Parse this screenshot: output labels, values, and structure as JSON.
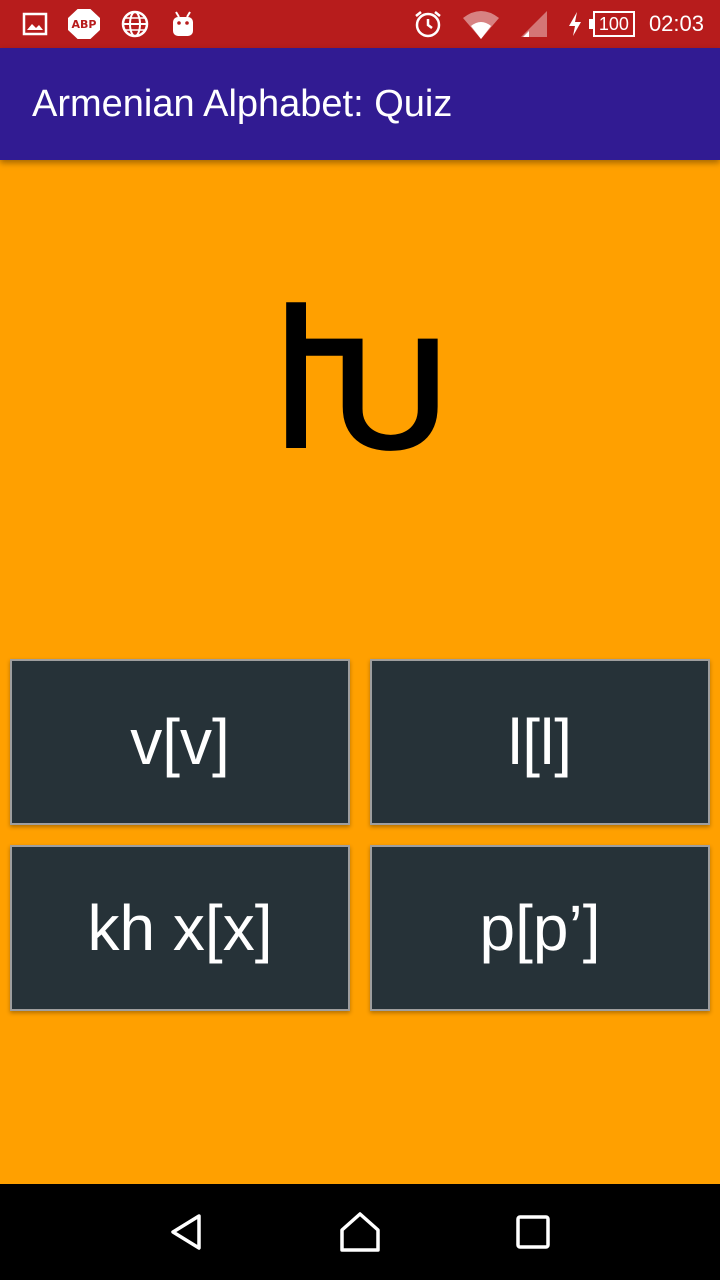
{
  "status_bar": {
    "icons_left": [
      "image-icon",
      "adblock-icon",
      "globe-icon",
      "android-icon"
    ],
    "adblock_label": "ABP",
    "battery": "100",
    "time": "02:03"
  },
  "app_bar": {
    "title": "Armenian Alphabet: Quiz"
  },
  "quiz": {
    "letter": "Խ",
    "answers": [
      "v[v]",
      "l[l]",
      "kh x[x]",
      "p[p’]"
    ]
  },
  "nav_bar": {
    "icons": [
      "back-icon",
      "home-icon",
      "recents-icon"
    ]
  },
  "colors": {
    "status_bar": "#B71C1C",
    "app_bar": "#311B92",
    "background": "#FFA000",
    "button": "#263238"
  }
}
